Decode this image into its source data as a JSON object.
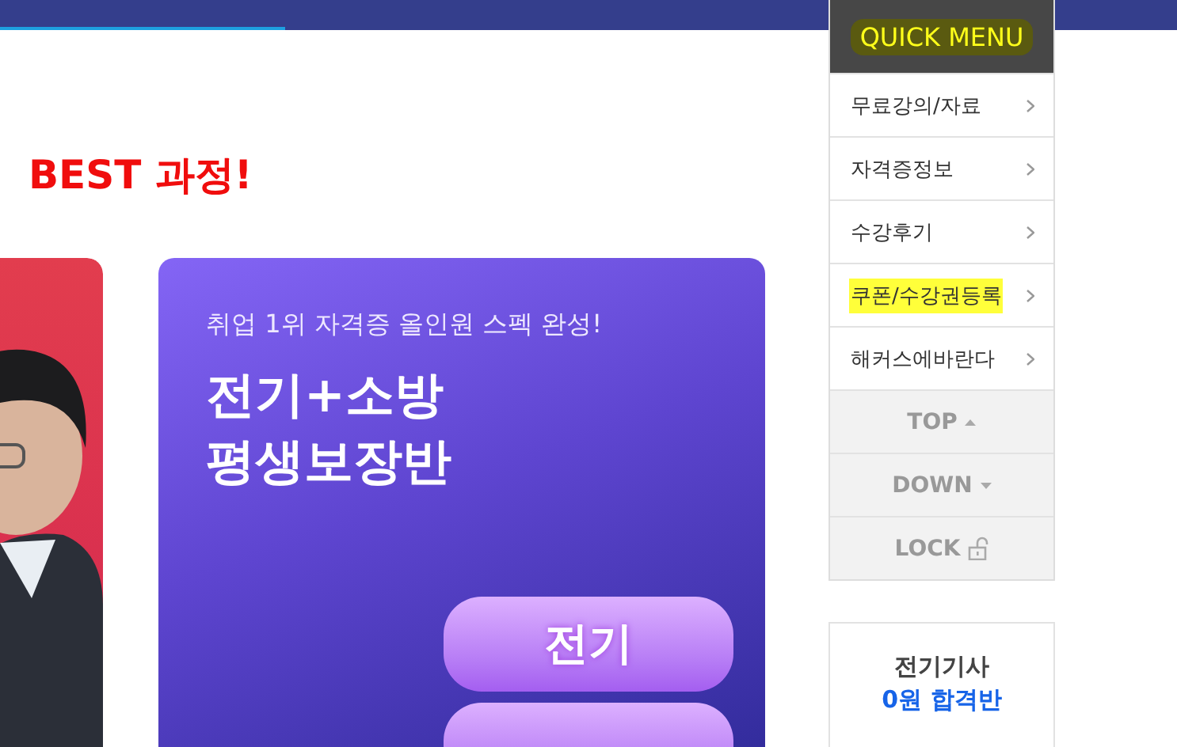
{
  "heading": {
    "highlight": "BEST 과정!"
  },
  "cards": [
    {
      "kind": "picture"
    },
    {
      "kind": "promo",
      "subtitle": "취업 1위 자격증 올인원 스펙 완성!",
      "title_lines": [
        "전기+소방",
        "평생보장반"
      ],
      "buttons": [
        {
          "kind": "label",
          "label": "전기"
        },
        {
          "kind": "cut"
        }
      ]
    }
  ],
  "quick_menu": {
    "title": "QUICK MENU",
    "title_highlighted": true,
    "items": [
      {
        "label": "무료강의/자료",
        "highlighted": false
      },
      {
        "label": "자격증정보",
        "highlighted": false
      },
      {
        "label": "수강후기",
        "highlighted": false
      },
      {
        "label": "쿠폰/수강권등록",
        "highlighted": true
      },
      {
        "label": "해커스에바란다",
        "highlighted": false
      }
    ],
    "nav": [
      {
        "kind": "up",
        "label": "TOP"
      },
      {
        "kind": "down",
        "label": "DOWN"
      },
      {
        "kind": "lock",
        "label": "LOCK"
      }
    ]
  },
  "side_banner": {
    "line1": "전기기사",
    "line2": "0원 합격반"
  }
}
